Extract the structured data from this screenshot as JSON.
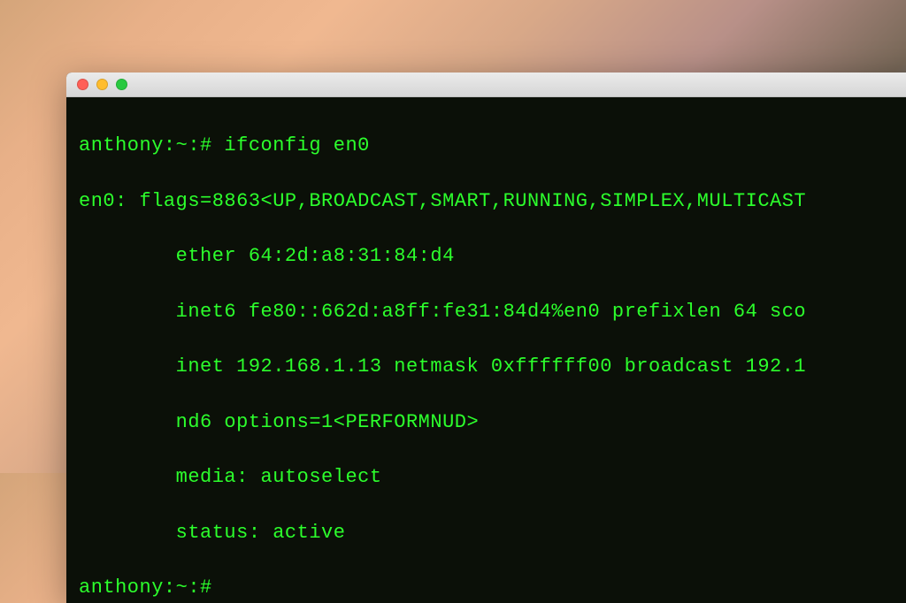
{
  "terminal": {
    "prompt1": "anthony:~:# ifconfig en0",
    "line_flags": "en0: flags=8863<UP,BROADCAST,SMART,RUNNING,SIMPLEX,MULTICAST",
    "line_ether": "        ether 64:2d:a8:31:84:d4",
    "line_inet6": "        inet6 fe80::662d:a8ff:fe31:84d4%en0 prefixlen 64 sco",
    "line_inet": "        inet 192.168.1.13 netmask 0xffffff00 broadcast 192.1",
    "line_nd6": "        nd6 options=1<PERFORMNUD>",
    "line_media": "        media: autoselect",
    "line_status": "        status: active",
    "prompt2": "anthony:~:#"
  },
  "traffic_lights": {
    "close": "close-window",
    "minimize": "minimize-window",
    "zoom": "zoom-window"
  }
}
